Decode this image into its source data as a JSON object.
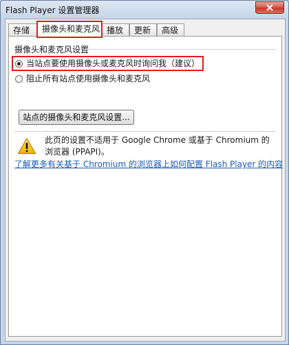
{
  "window": {
    "title": "Flash Player 设置管理器"
  },
  "tabs": [
    {
      "label": "存储",
      "active": false
    },
    {
      "label": "摄像头和麦克风",
      "active": true
    },
    {
      "label": "播放",
      "active": false
    },
    {
      "label": "更新",
      "active": false
    },
    {
      "label": "高级",
      "active": false
    }
  ],
  "section": {
    "title": "摄像头和麦克风设置",
    "options": [
      {
        "label": "当站点要使用摄像头或麦克风时询问我（建议）",
        "selected": true
      },
      {
        "label": "阻止所有站点使用摄像头和麦克风",
        "selected": false
      }
    ],
    "button_label": "站点的摄像头和麦克风设置..."
  },
  "notice": {
    "icon": "warning-icon",
    "text": "此页的设置不适用于 Google Chrome 或基于 Chromium 的浏览器 (PPAPI)。"
  },
  "link_text": "了解更多有关基于 Chromium 的浏览器上如何配置 Flash Player 的内容",
  "colors": {
    "highlight": "#e21b1b",
    "link": "#1a5bb5",
    "close": "#c0392b"
  }
}
